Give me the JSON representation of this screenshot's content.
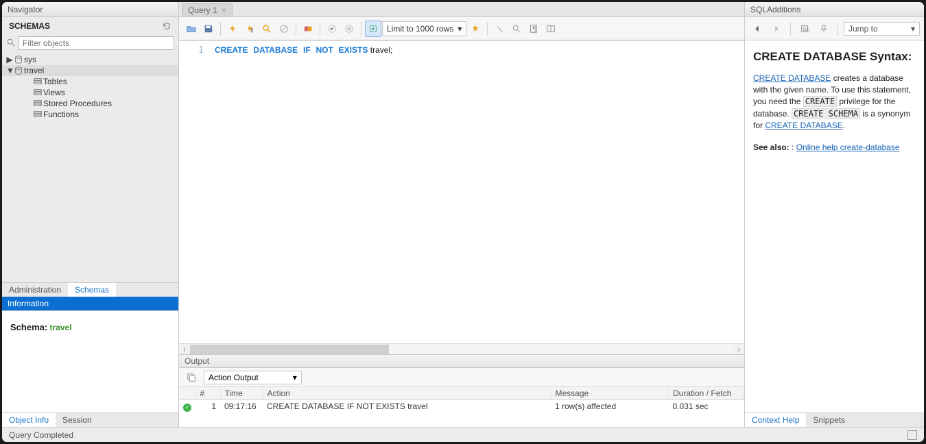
{
  "navigator": {
    "title": "Navigator",
    "schemas_label": "SCHEMAS",
    "filter_placeholder": "Filter objects",
    "tree": {
      "sys": "sys",
      "travel": "travel",
      "tables": "Tables",
      "views": "Views",
      "stored_procedures": "Stored Procedures",
      "functions": "Functions"
    },
    "tabs": {
      "administration": "Administration",
      "schemas": "Schemas"
    },
    "info_header": "Information",
    "info_label": "Schema:",
    "info_value": "travel",
    "footer_tabs": {
      "object_info": "Object Info",
      "session": "Session"
    }
  },
  "center": {
    "tab": "Query 1",
    "limit_label": "Limit to 1000 rows",
    "code": {
      "line_no": "1",
      "kw1": "CREATE",
      "kw2": "DATABASE",
      "kw3": "IF",
      "kw4": "NOT",
      "kw5": "EXISTS",
      "rest": " travel;"
    }
  },
  "output": {
    "panel_title": "Output",
    "selector": "Action Output",
    "cols": {
      "num": "#",
      "time": "Time",
      "action": "Action",
      "message": "Message",
      "duration": "Duration / Fetch"
    },
    "row": {
      "num": "1",
      "time": "09:17:16",
      "action": "CREATE DATABASE IF NOT EXISTS travel",
      "message": "1 row(s) affected",
      "duration": "0.031 sec"
    }
  },
  "right": {
    "title": "SQLAdditions",
    "jump": "Jump to",
    "help_title": "CREATE DATABASE Syntax:",
    "link1": "CREATE DATABASE",
    "p1a": " creates a database with the given name. To use this statement, you need the ",
    "code1": "CREATE",
    "p1b": " privilege for the database. ",
    "code2": "CREATE SCHEMA",
    "p1c": " is a synonym for ",
    "link2": "CREATE DATABASE",
    "p1d": ".",
    "see_also": "See also:",
    "colon": " : ",
    "link3": "Online help create-database",
    "tabs": {
      "context": "Context Help",
      "snippets": "Snippets"
    }
  },
  "status": {
    "text": "Query Completed"
  }
}
